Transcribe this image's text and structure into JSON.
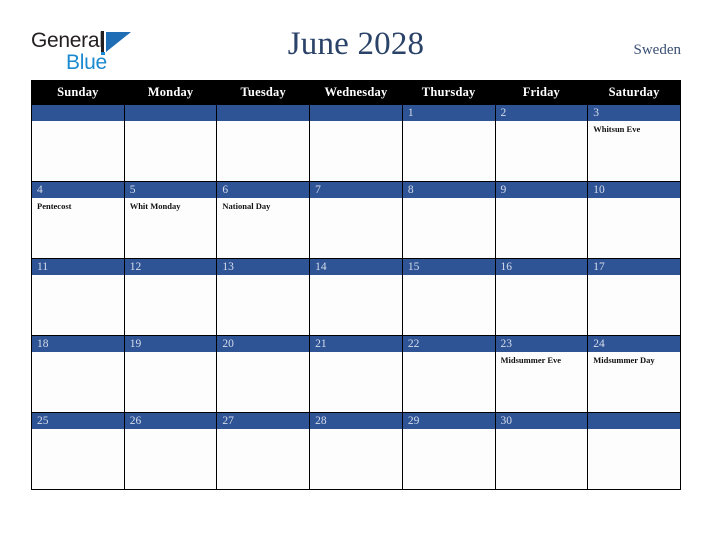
{
  "brand": {
    "word_general": "General",
    "word_blue": "Blue",
    "logo_icon": "triangle-logo-icon",
    "accent_blue": "#1c8ad1",
    "dark": "#231f20"
  },
  "header": {
    "title": "June 2028",
    "country": "Sweden",
    "title_color": "#2b4269"
  },
  "calendar": {
    "weekday_headers": [
      "Sunday",
      "Monday",
      "Tuesday",
      "Wednesday",
      "Thursday",
      "Friday",
      "Saturday"
    ],
    "header_bg": "#000000",
    "daybar_bg": "#2f5496",
    "daynum_color": "#d5dcea",
    "cell_bg": "#fdfdfd",
    "weeks": [
      [
        {
          "day": "",
          "events": []
        },
        {
          "day": "",
          "events": []
        },
        {
          "day": "",
          "events": []
        },
        {
          "day": "",
          "events": []
        },
        {
          "day": "1",
          "events": []
        },
        {
          "day": "2",
          "events": []
        },
        {
          "day": "3",
          "events": [
            "Whitsun Eve"
          ]
        }
      ],
      [
        {
          "day": "4",
          "events": [
            "Pentecost"
          ]
        },
        {
          "day": "5",
          "events": [
            "Whit Monday"
          ]
        },
        {
          "day": "6",
          "events": [
            "National Day"
          ]
        },
        {
          "day": "7",
          "events": []
        },
        {
          "day": "8",
          "events": []
        },
        {
          "day": "9",
          "events": []
        },
        {
          "day": "10",
          "events": []
        }
      ],
      [
        {
          "day": "11",
          "events": []
        },
        {
          "day": "12",
          "events": []
        },
        {
          "day": "13",
          "events": []
        },
        {
          "day": "14",
          "events": []
        },
        {
          "day": "15",
          "events": []
        },
        {
          "day": "16",
          "events": []
        },
        {
          "day": "17",
          "events": []
        }
      ],
      [
        {
          "day": "18",
          "events": []
        },
        {
          "day": "19",
          "events": []
        },
        {
          "day": "20",
          "events": []
        },
        {
          "day": "21",
          "events": []
        },
        {
          "day": "22",
          "events": []
        },
        {
          "day": "23",
          "events": [
            "Midsummer Eve"
          ]
        },
        {
          "day": "24",
          "events": [
            "Midsummer Day"
          ]
        }
      ],
      [
        {
          "day": "25",
          "events": []
        },
        {
          "day": "26",
          "events": []
        },
        {
          "day": "27",
          "events": []
        },
        {
          "day": "28",
          "events": []
        },
        {
          "day": "29",
          "events": []
        },
        {
          "day": "30",
          "events": []
        },
        {
          "day": "",
          "events": []
        }
      ]
    ]
  }
}
